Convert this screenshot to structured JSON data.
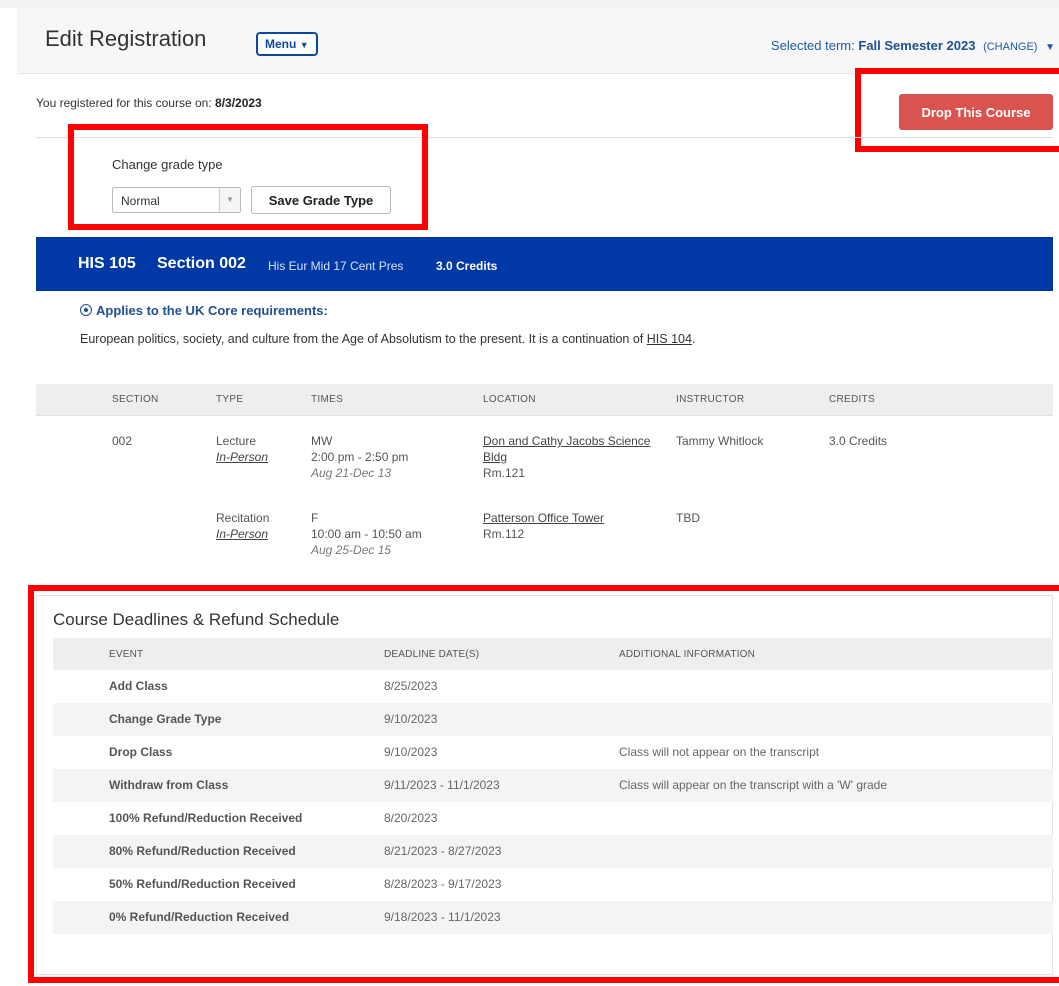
{
  "header": {
    "title": "Edit Registration",
    "menu_label": "Menu",
    "term_label": "Selected term:",
    "term_value": "Fall Semester 2023",
    "term_change": "(CHANGE)"
  },
  "registration": {
    "registered_label": "You registered for this course on:",
    "registered_date": "8/3/2023",
    "drop_label": "Drop This Course"
  },
  "grade": {
    "label": "Change grade type",
    "selected": "Normal",
    "save_label": "Save Grade Type"
  },
  "course": {
    "code": "HIS 105",
    "section": "Section 002",
    "name": "His Eur Mid 17 Cent Pres",
    "credits": "3.0 Credits",
    "core_req": "Applies to the UK Core requirements:",
    "description": "European politics, society, and culture from the Age of Absolutism to the present. It is a continuation of",
    "prereq_link": "HIS 104",
    "description_end": "."
  },
  "schedule": {
    "headers": [
      "SECTION",
      "TYPE",
      "TIMES",
      "LOCATION",
      "INSTRUCTOR",
      "CREDITS"
    ],
    "rows": [
      {
        "section": "002",
        "type": "Lecture",
        "mode": "In-Person",
        "days": "MW",
        "time": "2:00 pm - 2:50 pm",
        "dates": "Aug 21-Dec 13",
        "location_line1": "Don and Cathy Jacobs Science",
        "location_line2": "Bldg",
        "room": "Rm.121",
        "instructor": "Tammy Whitlock",
        "credits": "3.0 Credits"
      },
      {
        "section": "",
        "type": "Recitation",
        "mode": "In-Person",
        "days": "F",
        "time": "10:00 am - 10:50 am",
        "dates": "Aug 25-Dec 15",
        "location_line1": "Patterson Office Tower",
        "location_line2": "",
        "room": "Rm.112",
        "instructor": "TBD",
        "credits": ""
      }
    ]
  },
  "deadlines": {
    "title": "Course Deadlines & Refund Schedule",
    "headers": [
      "EVENT",
      "DEADLINE DATE(S)",
      "ADDITIONAL INFORMATION"
    ],
    "rows": [
      {
        "event": "Add Class",
        "date": "8/25/2023",
        "info": ""
      },
      {
        "event": "Change Grade Type",
        "date": "9/10/2023",
        "info": ""
      },
      {
        "event": "Drop Class",
        "date": "9/10/2023",
        "info": "Class will not appear on the transcript"
      },
      {
        "event": "Withdraw from Class",
        "date": "9/11/2023 - 11/1/2023",
        "info": "Class will appear on the transcript with a 'W' grade"
      },
      {
        "event": "100% Refund/Reduction Received",
        "date": "8/20/2023",
        "info": ""
      },
      {
        "event": "80% Refund/Reduction Received",
        "date": "8/21/2023 - 8/27/2023",
        "info": ""
      },
      {
        "event": "50% Refund/Reduction Received",
        "date": "8/28/2023 - 9/17/2023",
        "info": ""
      },
      {
        "event": "0% Refund/Reduction Received",
        "date": "9/18/2023 - 11/1/2023",
        "info": ""
      }
    ]
  },
  "colors": {
    "brand_blue": "#0039a6",
    "drop_red": "#d9534f",
    "highlight_red": "#ff0000"
  }
}
